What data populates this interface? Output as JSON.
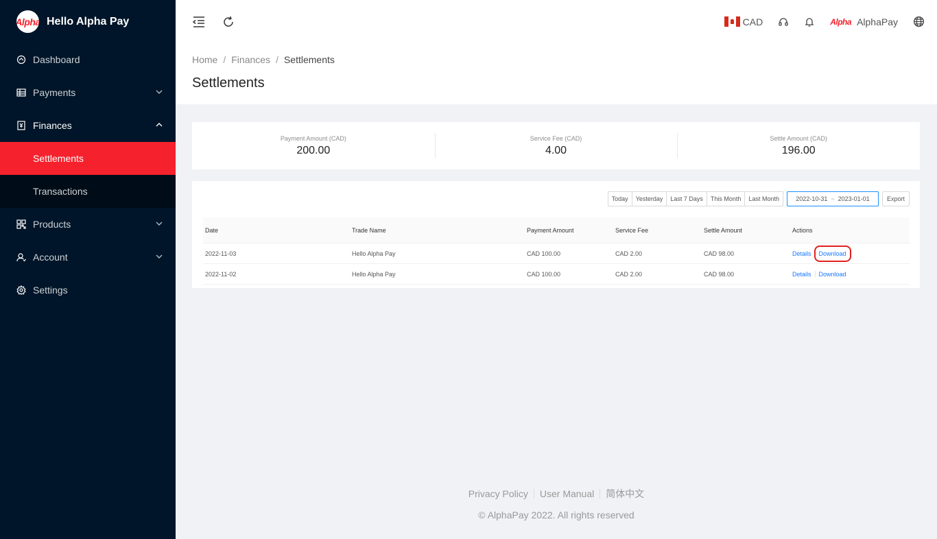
{
  "brand": {
    "logo_text": "Alpha",
    "title": "Hello Alpha Pay"
  },
  "sidebar": {
    "items": [
      {
        "label": "Dashboard"
      },
      {
        "label": "Payments"
      },
      {
        "label": "Finances"
      },
      {
        "label": "Settlements"
      },
      {
        "label": "Transactions"
      },
      {
        "label": "Products"
      },
      {
        "label": "Account"
      },
      {
        "label": "Settings"
      }
    ]
  },
  "header": {
    "currency": "CAD",
    "merchant_logo": "Alpha",
    "merchant_name": "AlphaPay"
  },
  "breadcrumb": [
    "Home",
    "Finances",
    "Settlements"
  ],
  "page_title": "Settlements",
  "stats": [
    {
      "label": "Payment Amount (CAD)",
      "value": "200.00"
    },
    {
      "label": "Service Fee (CAD)",
      "value": "4.00"
    },
    {
      "label": "Settle Amount (CAD)",
      "value": "196.00"
    }
  ],
  "filters": {
    "quick": [
      "Today",
      "Yesterday",
      "Last 7 Days",
      "This Month",
      "Last Month"
    ],
    "range_start": "2022-10-31",
    "range_sep": "~",
    "range_end": "2023-01-01",
    "export_label": "Export"
  },
  "table": {
    "columns": [
      "Date",
      "Trade Name",
      "Payment Amount",
      "Service Fee",
      "Settle Amount",
      "Actions"
    ],
    "rows": [
      {
        "date": "2022-11-03",
        "trade_name": "Hello Alpha Pay",
        "payment": "CAD 100.00",
        "fee": "CAD 2.00",
        "settle": "CAD 98.00",
        "details": "Details",
        "download": "Download"
      },
      {
        "date": "2022-11-02",
        "trade_name": "Hello Alpha Pay",
        "payment": "CAD 100.00",
        "fee": "CAD 2.00",
        "settle": "CAD 98.00",
        "details": "Details",
        "download": "Download"
      }
    ]
  },
  "footer": {
    "links": [
      "Privacy Policy",
      "User Manual",
      "简体中文"
    ],
    "copyright": "© AlphaPay 2022. All rights reserved"
  },
  "colors": {
    "sidebar_bg": "#001529",
    "accent": "#f5222d",
    "link": "#1677ff"
  }
}
